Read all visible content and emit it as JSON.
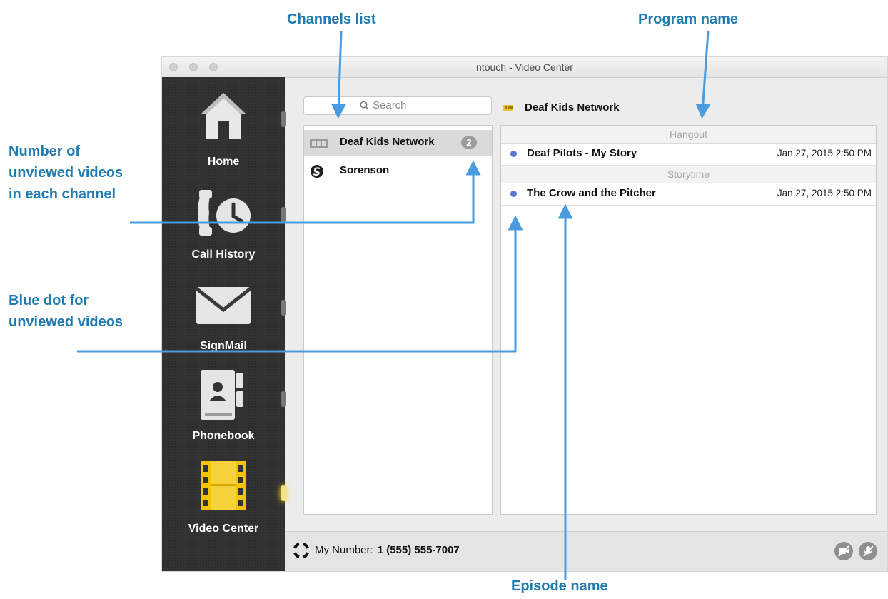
{
  "callouts": {
    "channels_list": "Channels list",
    "program_name": "Program name",
    "unviewed_count": "Number of unviewed videos in each channel",
    "blue_dot": "Blue dot for unviewed videos",
    "episode_name": "Episode name"
  },
  "window": {
    "title": "ntouch - Video Center"
  },
  "sidebar": {
    "items": [
      {
        "label": "Home",
        "icon": "home-icon"
      },
      {
        "label": "Call History",
        "icon": "call-history-icon"
      },
      {
        "label": "SignMail",
        "icon": "signmail-icon"
      },
      {
        "label": "Phonebook",
        "icon": "phonebook-icon"
      },
      {
        "label": "Video Center",
        "icon": "video-center-icon",
        "active": true
      }
    ]
  },
  "search": {
    "placeholder": "Search"
  },
  "channels": [
    {
      "name": "Deaf Kids Network",
      "unviewed": "2",
      "icon": "dkn-logo-icon",
      "selected": true
    },
    {
      "name": "Sorenson",
      "icon": "sorenson-logo-icon"
    }
  ],
  "program": {
    "title": "Deaf Kids Network"
  },
  "episodes": {
    "sections": [
      {
        "title": "Hangout",
        "items": [
          {
            "title": "Deaf Pilots - My Story",
            "date": "Jan 27, 2015 2:50 PM",
            "unviewed": true
          }
        ]
      },
      {
        "title": "Storytime",
        "items": [
          {
            "title": "The Crow and the Pitcher",
            "date": "Jan 27, 2015 2:50 PM",
            "unviewed": true
          }
        ]
      }
    ]
  },
  "footer": {
    "my_number_label": "My Number:",
    "my_number": "1 (555) 555-7007"
  },
  "colors": {
    "callout": "#1f7bb0",
    "arrow": "#4a9be0",
    "unviewed_dot": "#5a78d6",
    "active_nav": "#f5c400"
  }
}
